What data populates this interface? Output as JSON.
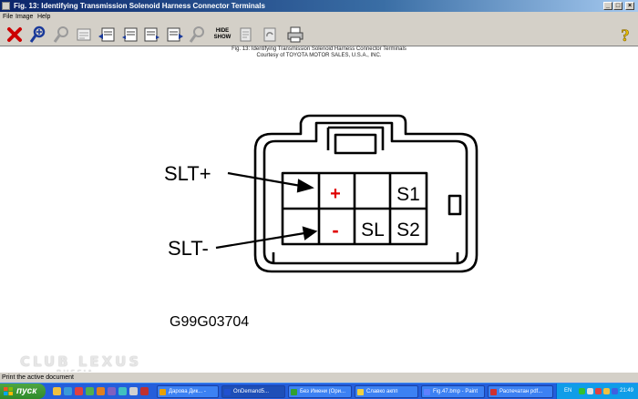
{
  "window": {
    "title": "Fig. 13: Identifying Transmission Solenoid Harness Connector Terminals",
    "minimize_glyph": "_",
    "maximize_glyph": "□",
    "close_glyph": "×"
  },
  "menu": {
    "file": "File",
    "image": "Image",
    "help": "Help"
  },
  "toolbar": {
    "hide_label": "HIDE",
    "show_label": "SHOW",
    "icons": [
      "close-x-icon",
      "zoom-in-icon",
      "zoom-out-icon",
      "notes-icon",
      "fig-first-icon",
      "fig-prev-icon",
      "fig-next-icon",
      "fig-last-icon",
      "search-icon",
      "hide-show-icon",
      "copy-icon",
      "rotate-icon",
      "print-icon",
      "help-icon"
    ],
    "colors": {
      "close": "#cc0000",
      "zoom": "#1a3a9a",
      "help": "#e8c000"
    }
  },
  "caption": {
    "line1": "Fig. 13: Identifying Transmission Solenoid Harness Connector Terminals",
    "line2": "Courtesy of TOYOTA MOTOR SALES, U.S.A., INC."
  },
  "diagram": {
    "label_slt_plus": "SLT+",
    "label_slt_minus": "SLT-",
    "cell_plus": "+",
    "cell_minus": "-",
    "cell_s1": "S1",
    "cell_sl": "SL",
    "cell_s2": "S2",
    "part_code": "G99G03704",
    "mark_color": "#e00000"
  },
  "watermark": {
    "line1": "CLUB LEXUS",
    "line2": "RUSSIA"
  },
  "status": {
    "text": "Print the active document"
  },
  "taskbar": {
    "start": "пуск",
    "tasks": [
      {
        "label": "Дарова Дик... -",
        "color": "#e8a000"
      },
      {
        "label": "OnDemand5...",
        "color": "#2050d0",
        "active": true
      },
      {
        "label": "Без Имени (Ори...",
        "color": "#30a030"
      },
      {
        "label": "Славко акпп",
        "color": "#f0d040"
      },
      {
        "label": "Fig.47.bmp - Paint",
        "color": "#6080ff"
      },
      {
        "label": "Распечатан pdf...",
        "color": "#d03030"
      }
    ],
    "tray_lang": "EN",
    "clock": "21:49"
  }
}
